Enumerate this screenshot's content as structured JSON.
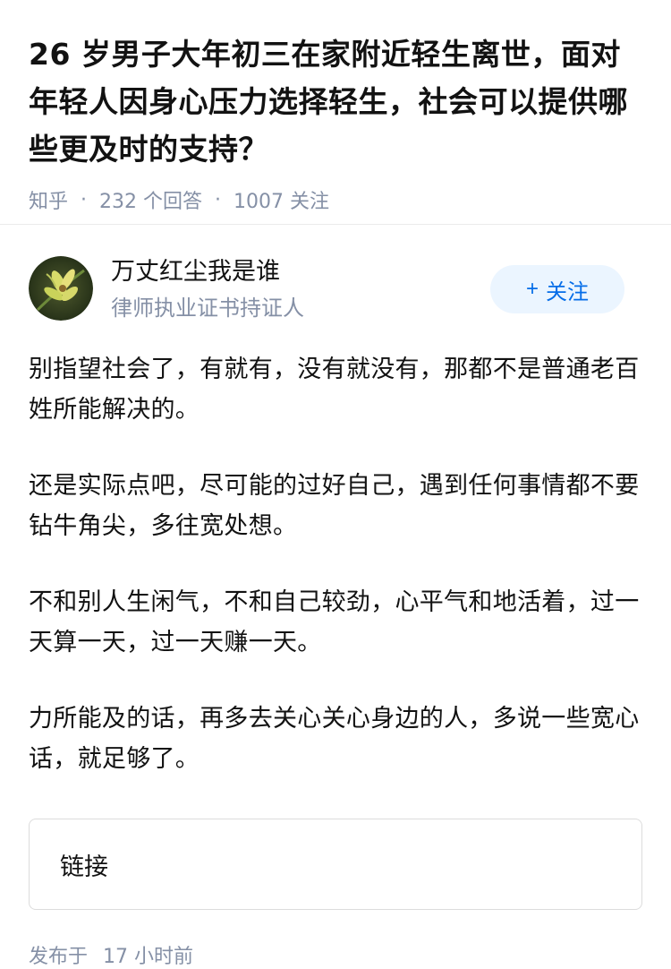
{
  "question": {
    "title": "26 岁男子大年初三在家附近轻生离世，面对年轻人因身心压力选择轻生，社会可以提供哪些更及时的支持？",
    "source": "知乎",
    "answer_count": "232 个回答",
    "follow_count": "1007 关注"
  },
  "author": {
    "name": "万丈红尘我是谁",
    "badge": "律师执业证书持证人",
    "follow_label": "关注",
    "follow_icon": "+"
  },
  "answer": {
    "paragraphs": [
      "别指望社会了，有就有，没有就没有，那都不是普通老百姓所能解决的。",
      "还是实际点吧，尽可能的过好自己，遇到任何事情都不要钻牛角尖，多往宽处想。",
      "不和别人生闲气，不和自己较劲，心平气和地活着，过一天算一天，过一天赚一天。",
      "力所能及的话，再多去关心关心身边的人，多说一些宽心话，就足够了。"
    ],
    "link_label": "链接",
    "publish_prefix": "发布于",
    "publish_time": "17 小时前"
  },
  "colors": {
    "accent": "#056de8",
    "accent_bg": "#ebf5ff",
    "meta_text": "#8590a6",
    "main_text": "#121212"
  }
}
